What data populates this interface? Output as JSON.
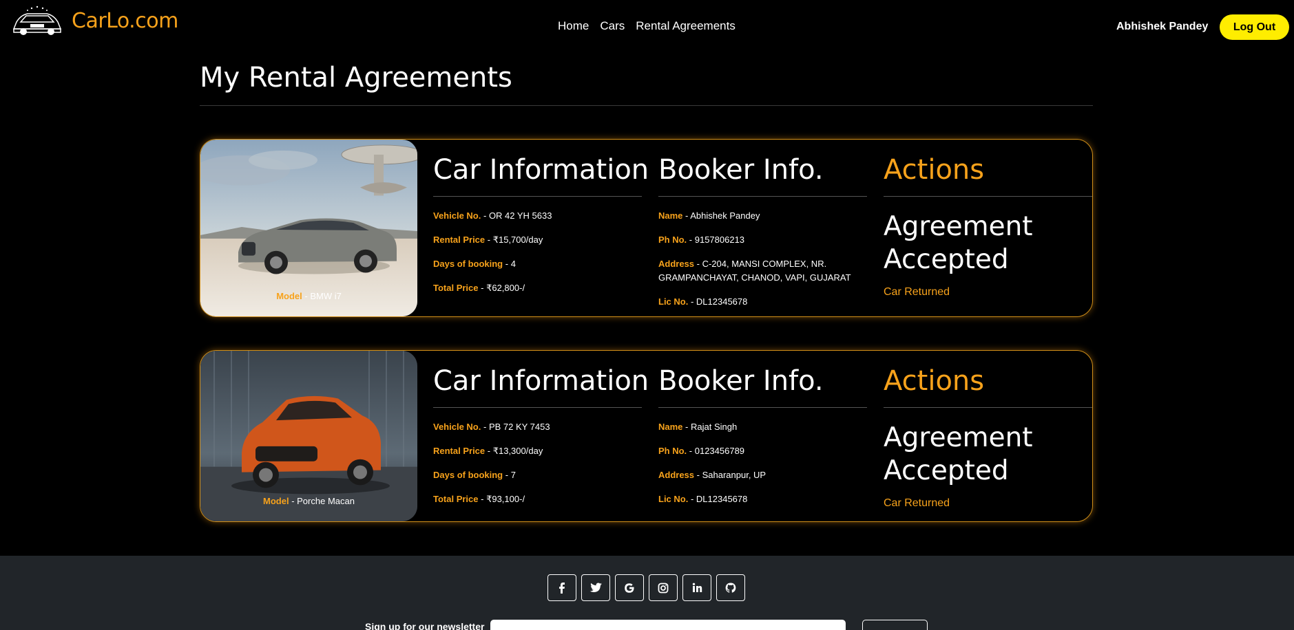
{
  "brand": {
    "name": "CarLo.com"
  },
  "nav": {
    "links": [
      "Home",
      "Cars",
      "Rental Agreements"
    ]
  },
  "user": {
    "name": "Abhishek Pandey",
    "logout_label": "Log Out"
  },
  "page": {
    "title": "My Rental Agreements"
  },
  "agreements": [
    {
      "car": {
        "model_label": "Model",
        "model": "BMW i7",
        "heading": "Car Information",
        "vehicle_label": "Vehicle No.",
        "vehicle": "OR 42 YH 5633",
        "price_label": "Rental Price",
        "price": "₹15,700/day",
        "days_label": "Days of booking",
        "days": "4",
        "total_label": "Total Price",
        "total": "₹62,800-/"
      },
      "booker": {
        "heading": "Booker Info.",
        "name_label": "Name",
        "name": "Abhishek Pandey",
        "phone_label": "Ph No.",
        "phone": "9157806213",
        "address_label": "Address",
        "address": "C-204, MANSI COMPLEX, NR. GRAMPANCHAYAT, CHANOD, VAPI, GUJARAT",
        "lic_label": "Lic No.",
        "lic": "DL12345678"
      },
      "actions": {
        "heading": "Actions",
        "status": "Agreement Accepted",
        "returned": "Car Returned"
      }
    },
    {
      "car": {
        "model_label": "Model",
        "model": "Porche Macan",
        "heading": "Car Information",
        "vehicle_label": "Vehicle No.",
        "vehicle": "PB 72 KY 7453",
        "price_label": "Rental Price",
        "price": "₹13,300/day",
        "days_label": "Days of booking",
        "days": "7",
        "total_label": "Total Price",
        "total": "₹93,100-/"
      },
      "booker": {
        "heading": "Booker Info.",
        "name_label": "Name",
        "name": "Rajat Singh",
        "phone_label": "Ph No.",
        "phone": "0123456789",
        "address_label": "Address",
        "address": "Saharanpur, UP",
        "lic_label": "Lic No.",
        "lic": "DL12345678"
      },
      "actions": {
        "heading": "Actions",
        "status": "Agreement Accepted",
        "returned": "Car Returned"
      }
    }
  ],
  "footer": {
    "social_icons": [
      "facebook-icon",
      "twitter-icon",
      "google-icon",
      "instagram-icon",
      "linkedin-icon",
      "github-icon"
    ],
    "newsletter_label": "Sign up for our newsletter"
  },
  "colors": {
    "accent": "#f7a21b",
    "logout_bg": "#ffed00",
    "footer_bg": "#212529"
  }
}
